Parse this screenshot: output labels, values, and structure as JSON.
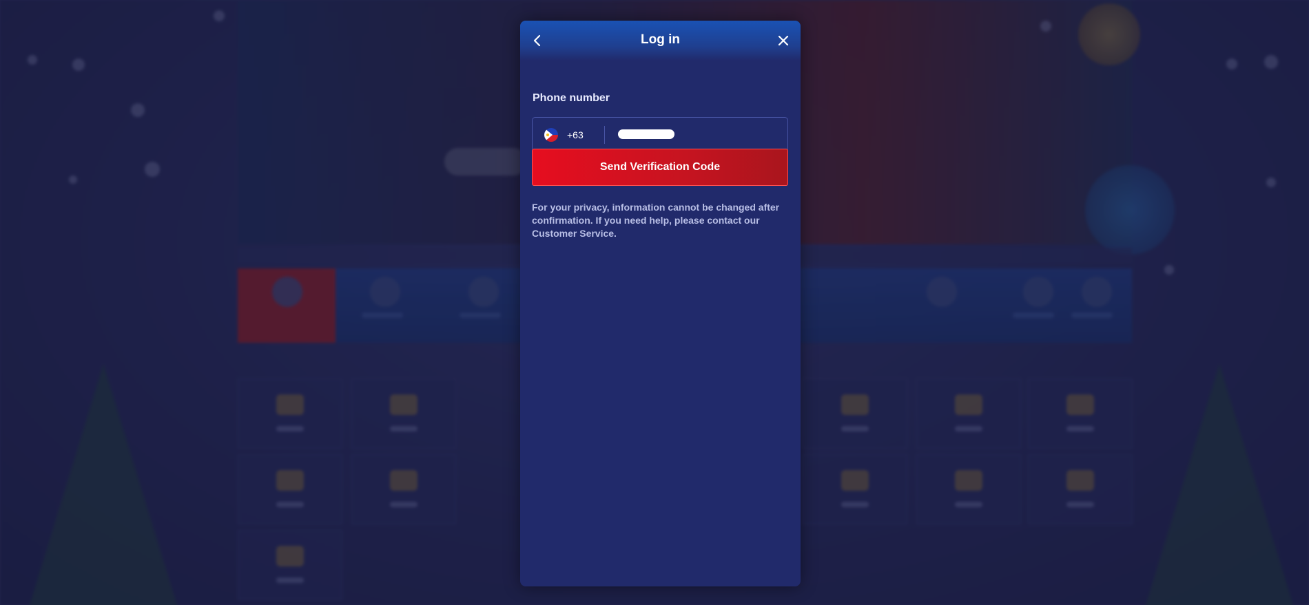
{
  "modal": {
    "title": "Log in",
    "back_icon": "chevron-left-icon",
    "close_icon": "close-icon"
  },
  "phone": {
    "label": "Phone number",
    "country_flag": "philippines-flag-icon",
    "dial_code": "+63",
    "value_masked": true
  },
  "actions": {
    "send_code_label": "Send Verification Code"
  },
  "notice": {
    "text": "For your privacy, information cannot be changed after confirmation. If you need help, please contact our Customer Service."
  },
  "colors": {
    "modal_bg": "#212a6b",
    "header_top": "#1a52b4",
    "primary_button": "#e60d1f",
    "text_primary": "#ffffff",
    "text_secondary": "#b9bfe6"
  }
}
